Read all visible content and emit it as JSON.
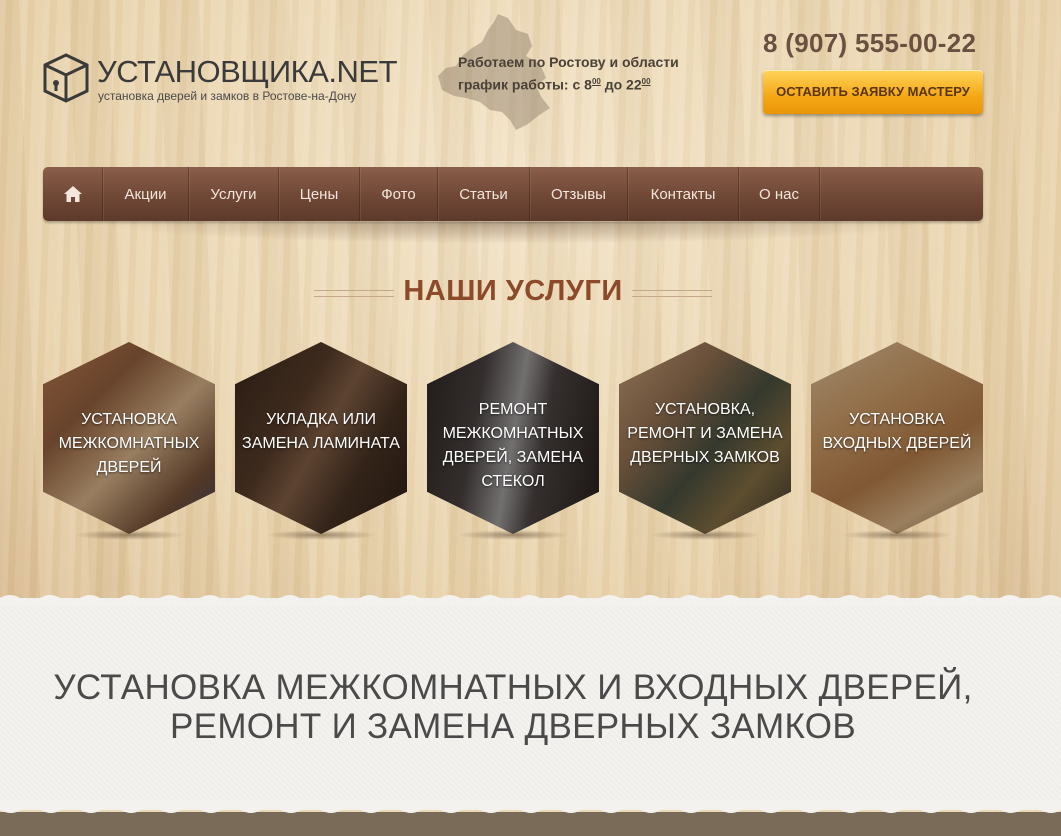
{
  "header": {
    "logo_title": "УСТАНОВЩИКА.NET",
    "logo_subtitle": "установка дверей и замков в Ростове-на-Дону",
    "work_line1": "Работаем по Ростову и области",
    "work_line2_prefix": "график работы: с 8",
    "work_from_min": "00",
    "work_line2_mid": " до 22",
    "work_to_min": "00",
    "phone": "8 (907) 555-00-22",
    "cta_label": "ОСТАВИТЬ ЗАЯВКУ МАСТЕРУ"
  },
  "nav": {
    "home_icon": "home-icon",
    "items": [
      "Акции",
      "Услуги",
      "Цены",
      "Фото",
      "Статьи",
      "Отзывы",
      "Контакты",
      "О нас"
    ]
  },
  "services": {
    "title": "НАШИ УСЛУГИ",
    "cards": [
      {
        "label": "УСТАНОВКА МЕЖКОМНАТНЫХ ДВЕРЕЙ"
      },
      {
        "label": "УКЛАДКА ИЛИ ЗАМЕНА ЛАМИНАТА"
      },
      {
        "label": "РЕМОНТ МЕЖКОМНАТНЫХ ДВЕРЕЙ, ЗАМЕНА СТЕКОЛ"
      },
      {
        "label": "УСТАНОВКА, РЕМОНТ И ЗАМЕНА ДВЕРНЫХ ЗАМКОВ"
      },
      {
        "label": "УСТАНОВКА ВХОДНЫХ ДВЕРЕЙ"
      }
    ]
  },
  "main": {
    "heading_line1": "УСТАНОВКА МЕЖКОМНАТНЫХ И ВХОДНЫХ ДВЕРЕЙ,",
    "heading_line2": "РЕМОНТ И ЗАМЕНА ДВЕРНЫХ ЗАМКОВ"
  },
  "colors": {
    "nav_bg": "#6f4735",
    "accent_button": "#f5a816",
    "section_title": "#8c4a2a",
    "phone": "#6a5040"
  }
}
